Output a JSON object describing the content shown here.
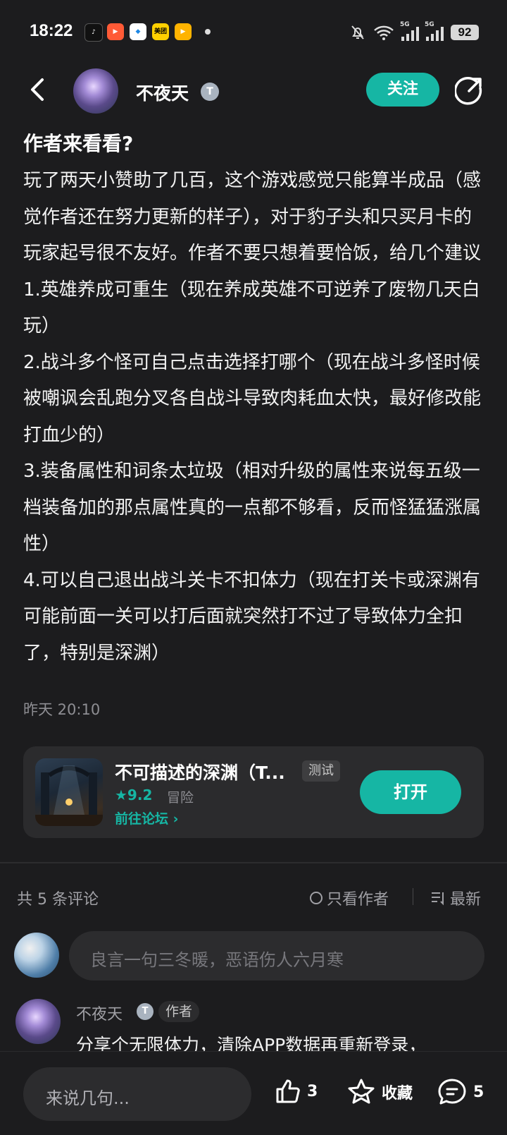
{
  "status_bar": {
    "time": "18:22",
    "battery": "92",
    "notif_meituan": "美团"
  },
  "header": {
    "author_name": "不夜天",
    "author_badge": "T",
    "follow_label": "关注"
  },
  "post": {
    "title": "作者来看看?",
    "paragraphs": [
      "玩了两天小赞助了几百，这个游戏感觉只能算半成品（感觉作者还在努力更新的样子），对于豹子头和只买月卡的玩家起号很不友好。作者不要只想着要恰饭，给几个建议",
      "1.英雄养成可重生（现在养成英雄不可逆养了废物几天白玩）",
      "2.战斗多个怪可自己点击选择打哪个（现在战斗多怪时候被嘲讽会乱跑分叉各自战斗导致肉耗血太快，最好修改能打血少的）",
      "3.装备属性和词条太垃圾（相对升级的属性来说每五级一档装备加的那点属性真的一点都不够看，反而怪猛猛涨属性）",
      "4.可以自己退出战斗关卡不扣体力（现在打关卡或深渊有可能前面一关可以打后面就突然打不过了导致体力全扣了，特别是深渊）"
    ],
    "time": "昨天 20:10"
  },
  "game_card": {
    "name": "不可描述的深渊（T...",
    "tag": "测试",
    "rating": "★9.2",
    "genre": "冒险",
    "forum_link": "前往论坛 ›",
    "open_label": "打开"
  },
  "comments_header": {
    "count_text": "共 5 条评论",
    "only_author": "只看作者",
    "sort_label": "最新"
  },
  "comment_input": {
    "placeholder": "良言一句三冬暖，恶语伤人六月寒"
  },
  "first_comment": {
    "name": "不夜天",
    "badge": "T",
    "tag": "作者",
    "text": "分享个无限体力，清除APP数据再重新登录，"
  },
  "bottom_bar": {
    "input_placeholder": "来说几句...",
    "like_count": "3",
    "favorite_label": "收藏",
    "comment_count": "5"
  },
  "colors": {
    "accent": "#16b6a4",
    "background": "#1c1c1e",
    "card": "#2b2b2d"
  }
}
